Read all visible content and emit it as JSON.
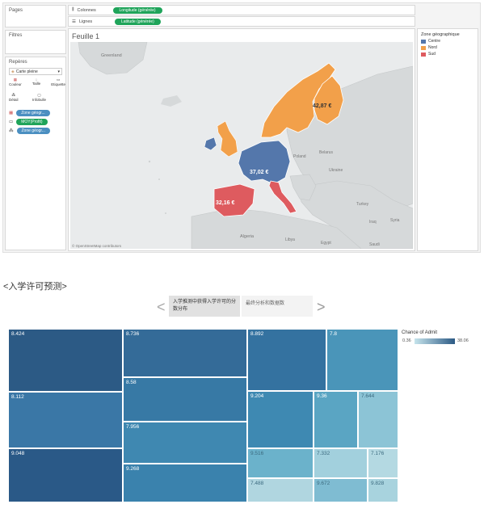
{
  "tableau": {
    "pages_label": "Pages",
    "filters_label": "Filtres",
    "marks_label": "Repères",
    "marktype": "Carte pleine",
    "mark_buttons": [
      "Couleur",
      "Taille",
      "Etiquette",
      "Détail",
      "Infobulle"
    ],
    "mark_fields": [
      "Zone géogr...",
      "MOY(Profit)",
      "Zone géogr..."
    ],
    "columns_label": "Colonnes",
    "columns_pill": "Longitude (générée)",
    "rows_label": "Lignes",
    "rows_pill": "Latitude (générée)",
    "sheet_title": "Feuille 1",
    "legend_title": "Zone géographique",
    "legend_items": [
      {
        "label": "Centre",
        "color": "#5477ab"
      },
      {
        "label": "Nord",
        "color": "#f2a04a"
      },
      {
        "label": "Sud",
        "color": "#de5b5f"
      }
    ],
    "map_values": {
      "nord": "42,87 €",
      "centre": "37,02 €",
      "sud": "32,16 €"
    },
    "map_places": [
      "Greenland",
      "Poland",
      "Belarus",
      "Ukraine",
      "Turkey",
      "Iraq",
      "Syria",
      "Algeria",
      "Libya",
      "Egypt",
      "Saudi"
    ],
    "attribution": "© OpenStreetMap contributors"
  },
  "dashboard": {
    "heading": "<入学许可预测>",
    "nav_prev": "<",
    "nav_next": ">",
    "tab_active": "入学推测中获得入学许可的分数分布",
    "tab_inactive": "最终分析和数据数",
    "legend_title": "Chance of Admit",
    "legend_min": "0.36",
    "legend_max": "38.06"
  },
  "chart_data": {
    "type": "heatmap",
    "title": "",
    "color_legend": {
      "label": "Chance of Admit",
      "min": 0.36,
      "max": 38.06
    },
    "cells": [
      {
        "label": "8.424",
        "color": "#2c5a85"
      },
      {
        "label": "8.112",
        "color": "#3a77a6"
      },
      {
        "label": "9.048",
        "color": "#2a5987"
      },
      {
        "label": "8.736",
        "color": "#346b98"
      },
      {
        "label": "8.58",
        "color": "#3779a5"
      },
      {
        "label": "7.956",
        "color": "#3f88b1"
      },
      {
        "label": "9.268",
        "color": "#3a82ad"
      },
      {
        "label": "8.892",
        "color": "#3472a0"
      },
      {
        "label": "7.8",
        "color": "#4a95b9"
      },
      {
        "label": "9.204",
        "color": "#3e89b2"
      },
      {
        "label": "9.36",
        "color": "#5aa5c3"
      },
      {
        "label": "7.644",
        "color": "#8cc4d6"
      },
      {
        "label": "9.516",
        "color": "#6bb2cb"
      },
      {
        "label": "7.332",
        "color": "#a2d0dd"
      },
      {
        "label": "7.176",
        "color": "#b4d9e2"
      },
      {
        "label": "7.488",
        "color": "#b0d6e0"
      },
      {
        "label": "9.672",
        "color": "#7fbcd2"
      },
      {
        "label": "9.828",
        "color": "#a8d3de"
      }
    ]
  }
}
